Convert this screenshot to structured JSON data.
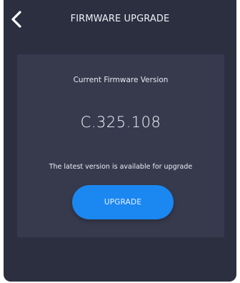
{
  "header": {
    "title": "FIRMWARE UPGRADE",
    "back_icon": "chevron-left-icon"
  },
  "firmware": {
    "label": "Current Firmware Version",
    "version": "C.325.108",
    "status_text": "The latest version is available for upgrade"
  },
  "actions": {
    "upgrade_label": "UPGRADE"
  },
  "colors": {
    "background": "#2c2f40",
    "card": "#373a4d",
    "accent": "#1b87f0",
    "text": "#eef0f6"
  }
}
